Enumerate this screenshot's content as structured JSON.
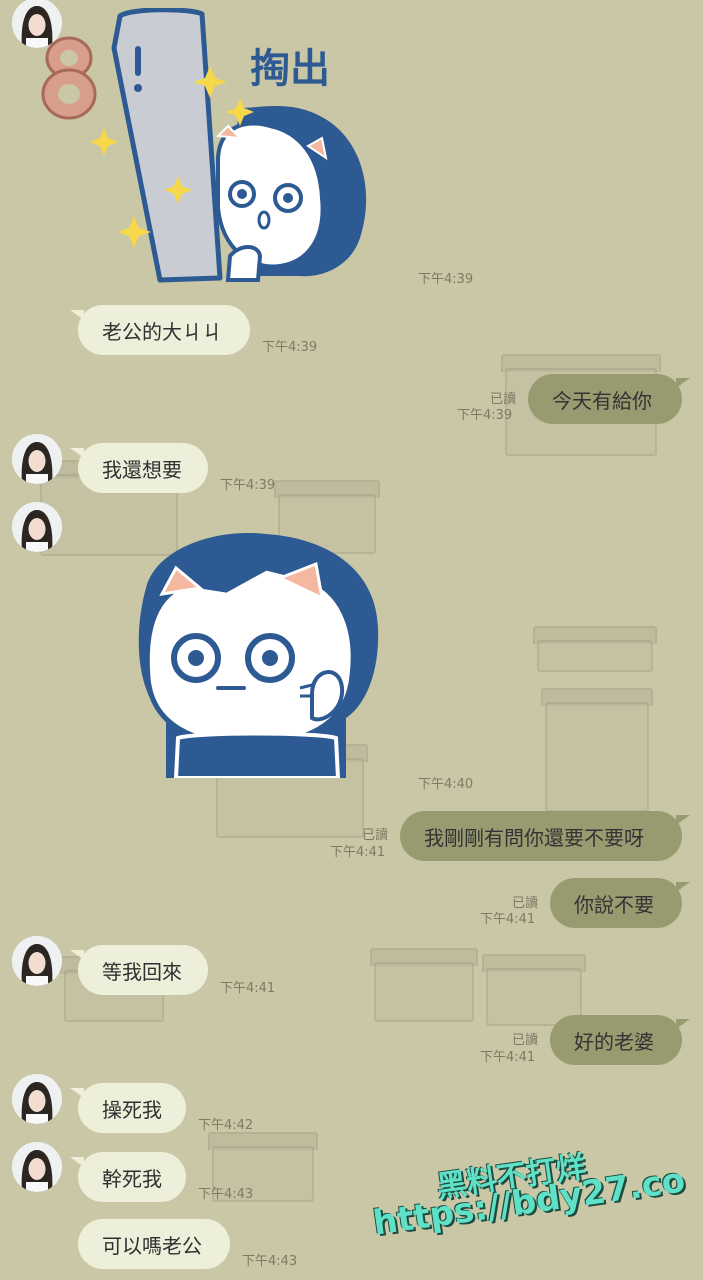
{
  "sticker1": {
    "caption": "掏出",
    "badge": "8"
  },
  "messages": [
    {
      "id": "m1",
      "side": "in",
      "text": "老公的大ㄐㄐ",
      "time": "下午4:39"
    },
    {
      "id": "m2",
      "side": "out",
      "text": "今天有給你",
      "time": "下午4:39",
      "read": "已讀"
    },
    {
      "id": "m3",
      "side": "in",
      "text": "我還想要",
      "time": "下午4:39"
    },
    {
      "id": "m4",
      "side": "out",
      "text": "我剛剛有問你還要不要呀",
      "time": "下午4:41",
      "read": "已讀"
    },
    {
      "id": "m5",
      "side": "out",
      "text": "你說不要",
      "time": "下午4:41",
      "read": "已讀"
    },
    {
      "id": "m6",
      "side": "in",
      "text": "等我回來",
      "time": "下午4:41"
    },
    {
      "id": "m7",
      "side": "out",
      "text": "好的老婆",
      "time": "下午4:41",
      "read": "已讀"
    },
    {
      "id": "m8",
      "side": "in",
      "text": "操死我",
      "time": "下午4:42"
    },
    {
      "id": "m9",
      "side": "in",
      "text": "幹死我",
      "time": "下午4:43"
    },
    {
      "id": "m10",
      "side": "in",
      "text": "可以嗎老公",
      "time": "下午4:43"
    }
  ],
  "sticker1_time": "下午4:39",
  "sticker2_time": "下午4:40",
  "watermark": {
    "line1": "黑料不打烊",
    "line2": "https://bdy27.co"
  },
  "colors": {
    "background": "#c9c7a6",
    "incoming": "#eeefdb",
    "outgoing": "#989a70",
    "cat_hair": "#2d5a93"
  }
}
